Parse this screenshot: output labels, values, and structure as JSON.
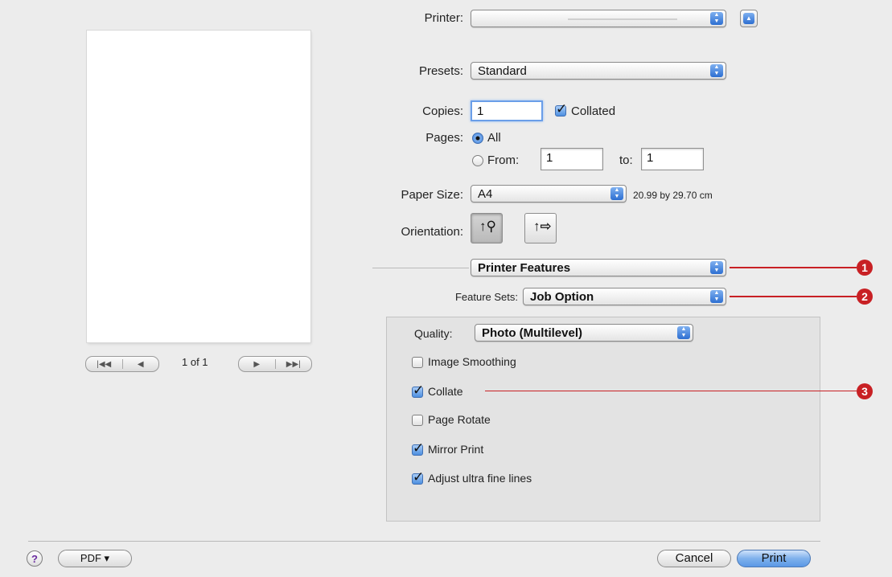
{
  "printer": {
    "label": "Printer:",
    "value": ""
  },
  "presets": {
    "label": "Presets:",
    "value": "Standard"
  },
  "copies": {
    "label": "Copies:",
    "value": "1",
    "collated_label": "Collated",
    "collated": true
  },
  "pages": {
    "label": "Pages:",
    "all_label": "All",
    "from_label": "From:",
    "from_value": "1",
    "to_label": "to:",
    "to_value": "1",
    "selected": "All"
  },
  "paper_size": {
    "label": "Paper Size:",
    "value": "A4",
    "dimensions": "20.99 by 29.70 cm"
  },
  "orientation": {
    "label": "Orientation:"
  },
  "panel_popup": {
    "value": "Printer Features"
  },
  "feature_sets": {
    "label": "Feature Sets:",
    "value": "Job Option"
  },
  "quality": {
    "label": "Quality:",
    "value": "Photo (Multilevel)"
  },
  "options": [
    {
      "label": "Image Smoothing",
      "checked": false
    },
    {
      "label": "Collate",
      "checked": true
    },
    {
      "label": "Page Rotate",
      "checked": false
    },
    {
      "label": "Mirror Print",
      "checked": true
    },
    {
      "label": "Adjust ultra fine lines",
      "checked": true
    }
  ],
  "preview_nav": {
    "page_indicator": "1 of 1"
  },
  "footer": {
    "help_label": "?",
    "pdf_label": "PDF ▾",
    "cancel_label": "Cancel",
    "print_label": "Print"
  },
  "callouts": [
    "1",
    "2",
    "3"
  ],
  "icons": {
    "popup_arrows": "updown-arrows-icon",
    "collapse": "disclosure-up-icon",
    "portrait": "portrait-orientation-icon",
    "landscape": "landscape-orientation-icon"
  },
  "colors": {
    "callout": "#c82024",
    "accent": "#3d7fd8"
  }
}
